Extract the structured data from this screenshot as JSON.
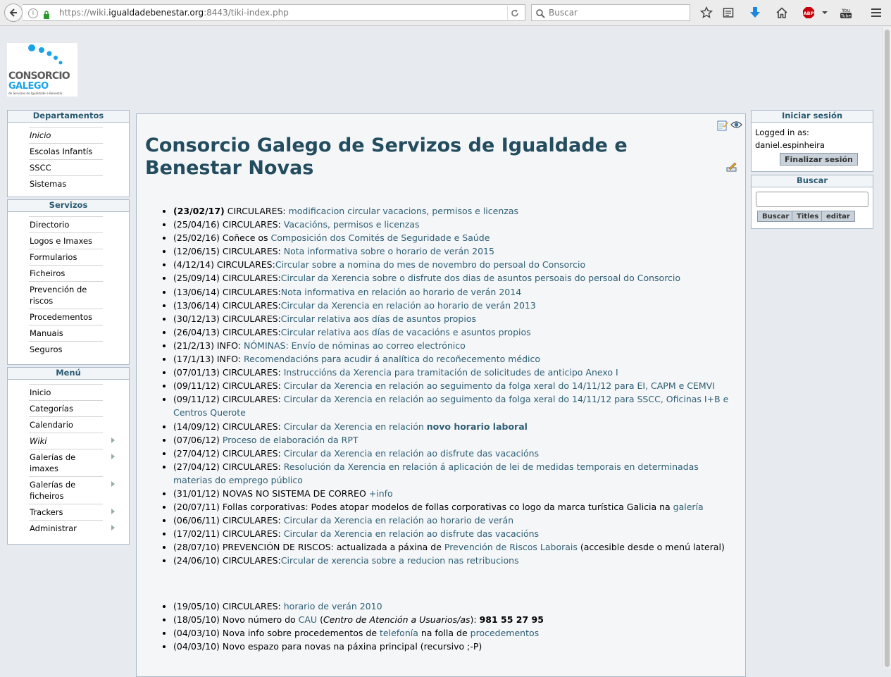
{
  "browser": {
    "url_prefix": "https://wiki.",
    "url_domain": "igualdadebenestar.org",
    "url_suffix": ":8443/tiki-index.php",
    "search_placeholder": "Buscar"
  },
  "logo": {
    "line1": "CONSORCIO",
    "line2": "GALEGO",
    "line3": "de Servizos de Igualdade e Benestar"
  },
  "departamentos": {
    "title": "Departamentos",
    "items": [
      "Inicio",
      "Escolas Infantís",
      "SSCC",
      "Sistemas"
    ]
  },
  "servizos": {
    "title": "Servizos",
    "items": [
      "Directorio",
      "Logos e Imaxes",
      "Formularios",
      "Ficheiros",
      "Prevención de riscos",
      "Procedementos",
      "Manuais",
      "Seguros"
    ]
  },
  "menu": {
    "title": "Menú",
    "items": [
      "Inicio",
      "Categorías",
      "Calendario",
      "Wiki",
      "Galerías de imaxes",
      "Galerías de ficheiros",
      "Trackers",
      "Administrar"
    ]
  },
  "login": {
    "title": "Iniciar sesión",
    "logged_label": "Logged in as:",
    "username": "daniel.espinheira",
    "logout_button": "Finalizar sesión"
  },
  "search_box": {
    "title": "Buscar",
    "btn_search": "Buscar",
    "btn_titles": "Titles",
    "btn_edit": "editar"
  },
  "main": {
    "title": "Consorcio Galego de Servizos de Igualdade e Benestar Novas",
    "news": [
      {
        "date": "(23/02/17)",
        "prefix": " CIRCULARES: ",
        "link": "modificacion circular vacacions, permisos e licenzas",
        "suffix": ""
      },
      {
        "date": "(25/04/16)",
        "prefix": " CIRCULARES: ",
        "link": "Vacacións, permisos e licenzas",
        "suffix": ""
      },
      {
        "date": "(25/02/16)",
        "prefix": " Coñece os ",
        "link": "Composición dos Comités de Seguridade e Saúde",
        "suffix": ""
      },
      {
        "date": "(12/06/15)",
        "prefix": " CIRCULARES: ",
        "link": "Nota informativa sobre o horario de verán 2015",
        "suffix": ""
      },
      {
        "date": "(4/12/14)",
        "prefix": " CIRCULARES:",
        "link": "Circular sobre a nomina do mes de novembro do persoal do Consorcio",
        "suffix": ""
      },
      {
        "date": "(25/09/14)",
        "prefix": " CIRCULARES:",
        "link": "Circular da Xerencia sobre o disfrute dos dias de asuntos persoais do persoal do Consorcio",
        "suffix": ""
      },
      {
        "date": "(13/06/14)",
        "prefix": " CIRCULARES:",
        "link": "Nota informativa en relación ao horario de verán 2014",
        "suffix": ""
      },
      {
        "date": "(13/06/14)",
        "prefix": " CIRCULARES:",
        "link": "Circular da Xerencia en relación ao horario de verán 2013",
        "suffix": ""
      },
      {
        "date": "(30/12/13)",
        "prefix": " CIRCULARES:",
        "link": "Circular relativa aos días de asuntos propios",
        "suffix": ""
      },
      {
        "date": "(26/04/13)",
        "prefix": " CIRCULARES:",
        "link": "Circular relativa aos días de vacacións e asuntos propios",
        "suffix": ""
      },
      {
        "date": "(21/2/13)",
        "prefix": " INFO: ",
        "link": "NÓMINAS: Envío de nóminas ao correo electrónico",
        "suffix": ""
      },
      {
        "date": "(17/1/13)",
        "prefix": " INFO: ",
        "link": "Recomendacións para acudir á analítica do recoñecemento médico",
        "suffix": ""
      },
      {
        "date": "(07/01/13)",
        "prefix": " CIRCULARES: ",
        "link": "Instruccións da Xerencia para tramitación de solicitudes de anticipo Anexo I",
        "suffix": ""
      },
      {
        "date": "(09/11/12)",
        "prefix": " CIRCULARES: ",
        "link": "Circular da Xerencia en relación ao seguimento da folga xeral do 14/11/12 para EI, CAPM e CEMVI",
        "suffix": ""
      },
      {
        "date": "(09/11/12)",
        "prefix": " CIRCULARES: ",
        "link": "Circular da Xerencia en relación ao seguimento da folga xeral do 14/11/12 para SSCC, Oficinas I+B e Centros Querote",
        "suffix": ""
      },
      {
        "date": "(14/09/12)",
        "prefix": " CIRCULARES: ",
        "link": "Circular da Xerencia en relación ",
        "link_bold": "novo horario laboral",
        "suffix": ""
      },
      {
        "date": "(07/06/12)",
        "prefix": " ",
        "link": "Proceso de elaboración da RPT",
        "suffix": ""
      },
      {
        "date": "(27/04/12)",
        "prefix": " CIRCULARES: ",
        "link": "Circular da Xerencia en relación ao disfrute das vacacións",
        "suffix": ""
      },
      {
        "date": "(27/04/12)",
        "prefix": " CIRCULARES: ",
        "link": "Resolución da Xerencia en relación á aplicación de lei de medidas temporais en determinadas materias do emprego público",
        "suffix": ""
      },
      {
        "date": "(31/01/12)",
        "prefix": " NOVAS NO SISTEMA DE CORREO ",
        "link": "+info",
        "suffix": ""
      },
      {
        "date": "(20/07/11)",
        "prefix": " Follas corporativas: Podes atopar modelos de follas corporativas co logo da marca turística Galicia na ",
        "link": "galería",
        "suffix": ""
      },
      {
        "date": "(06/06/11)",
        "prefix": " CIRCULARES: ",
        "link": "Circular da Xerencia en relación ao horario de verán",
        "suffix": ""
      },
      {
        "date": "(17/02/11)",
        "prefix": " CIRCULARES: ",
        "link": "Circular da Xerencia en relación ao disfrute das vacacións",
        "suffix": ""
      },
      {
        "date": "(28/07/10)",
        "prefix": " PREVENCIÓN DE RISCOS: actualizada a páxina de ",
        "link": "Prevención de Riscos Laborais",
        "suffix": " (accesible desde o menú lateral)"
      },
      {
        "date": "(24/06/10)",
        "prefix": " CIRCULARES:",
        "link": "Circular de xerencia sobre a reducion nas retribucions",
        "suffix": ""
      }
    ],
    "news2": [
      {
        "date": "(19/05/10)",
        "prefix": " CIRCULARES: ",
        "link": "horario de verán 2010"
      },
      {
        "date": "(18/05/10)",
        "prefix": " Novo número do ",
        "link": "CAU",
        "italic": "Centro de Atención a Usuarios/as",
        "phone": "981 55 27 95"
      },
      {
        "date": "(04/03/10)",
        "prefix": " Nova info sobre procedementos de ",
        "link": "telefonía",
        "mid": " na folla de ",
        "link2": "procedementos"
      },
      {
        "date": "(04/03/10)",
        "prefix": " Novo espazo para novas na páxina principal (recursivo ;-P)",
        "link": ""
      }
    ]
  }
}
